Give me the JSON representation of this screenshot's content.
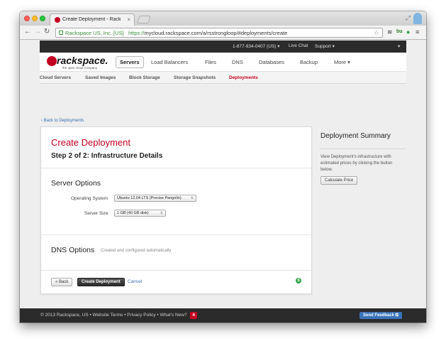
{
  "browser": {
    "tab_title": "Create Deployment - Rack",
    "tab_close": "×",
    "site_identity": "Rackspace US, Inc. [US]",
    "url_scheme": "https://",
    "url_rest": "mycloud.rackspace.com/a/rsstrongloop/#deployments/create"
  },
  "topbar": {
    "phone": "1-877-934-0407 (US) ▾",
    "live_chat": "Live Chat",
    "support": "Support ▾",
    "account": "▾"
  },
  "logo": {
    "word": "rackspace.",
    "tagline": "the open cloud company"
  },
  "main_nav": [
    "Servers",
    "Load Balancers",
    "Files",
    "DNS",
    "Databases",
    "Backup",
    "More ▾"
  ],
  "sub_nav": [
    "Cloud Servers",
    "Saved Images",
    "Block Storage",
    "Storage Snapshots",
    "Deployments"
  ],
  "back_link": "‹ Back to Deployments",
  "card": {
    "title": "Create Deployment",
    "step": "Step 2 of 2: Infrastructure Details",
    "server_options_title": "Server Options",
    "os_label": "Operating System",
    "os_value": "Ubuntu 12.04 LTS (Precise Pangolin)",
    "size_label": "Server Size",
    "size_value": "1 GB (40 GB disk)",
    "select_arrows": "⇕",
    "dns_title": "DNS Options",
    "dns_note": "Created and configured automatically",
    "back_button": "« Back",
    "create_button": "Create Deployment",
    "cancel_link": "Cancel",
    "dollar_icon": "$"
  },
  "summary": {
    "title": "Deployment Summary",
    "text": "View Deployment's infrastructure with estimated prices by clicking the button below.",
    "button": "Calculate Price"
  },
  "footer": {
    "text": "© 2013 Rackspace, US • Website Terms • Privacy Policy • What's New?",
    "news_count": "4",
    "feedback_button": "Send Feedback ⧉"
  },
  "colors": {
    "brand_red": "#c40022",
    "link_blue": "#3a6fb0",
    "dark_bar": "#2b2b2b",
    "feedback_blue": "#3a73b8"
  }
}
